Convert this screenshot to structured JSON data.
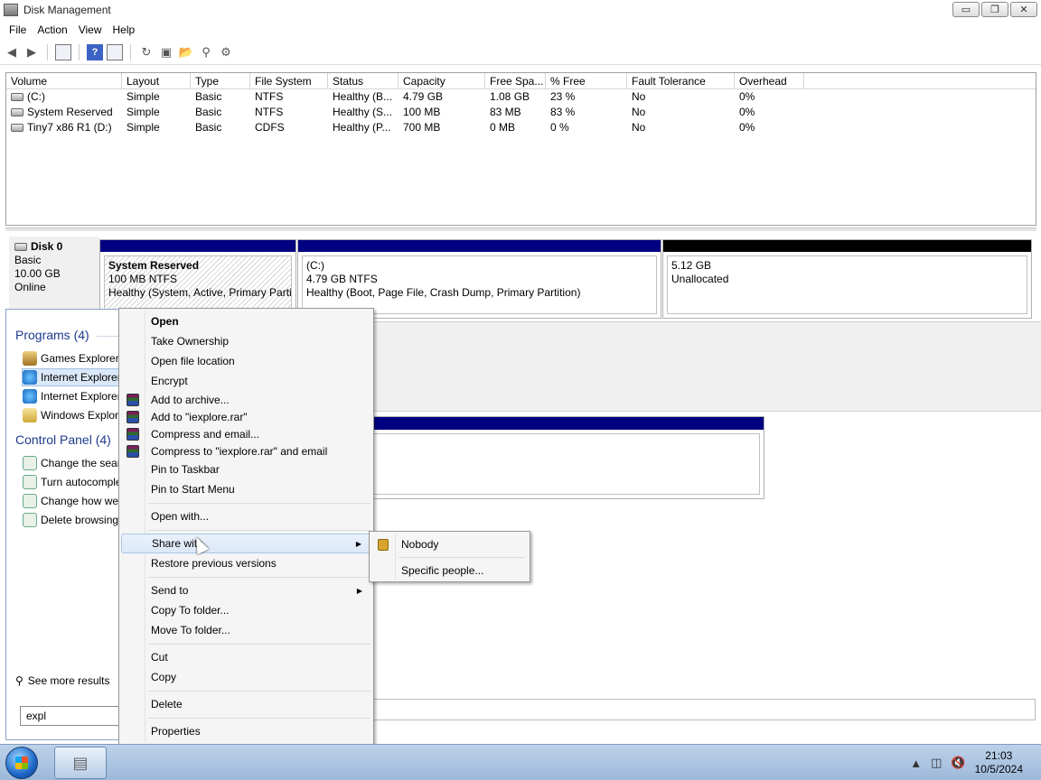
{
  "window": {
    "title": "Disk Management",
    "minimize": "▭",
    "maximize": "❐",
    "close": "✕"
  },
  "menubar": [
    {
      "label": "File"
    },
    {
      "label": "Action"
    },
    {
      "label": "View"
    },
    {
      "label": "Help"
    }
  ],
  "volumes": {
    "columns": [
      "Volume",
      "Layout",
      "Type",
      "File System",
      "Status",
      "Capacity",
      "Free Spa...",
      "% Free",
      "Fault Tolerance",
      "Overhead"
    ],
    "rows": [
      [
        "(C:)",
        "Simple",
        "Basic",
        "NTFS",
        "Healthy (B...",
        "4.79 GB",
        "1.08 GB",
        "23 %",
        "No",
        "0%"
      ],
      [
        "System Reserved",
        "Simple",
        "Basic",
        "NTFS",
        "Healthy (S...",
        "100 MB",
        "83 MB",
        "83 %",
        "No",
        "0%"
      ],
      [
        "Tiny7 x86 R1 (D:)",
        "Simple",
        "Basic",
        "CDFS",
        "Healthy (P...",
        "700 MB",
        "0 MB",
        "0 %",
        "No",
        "0%"
      ]
    ]
  },
  "disk0": {
    "name": "Disk 0",
    "type": "Basic",
    "size": "10.00 GB",
    "status": "Online",
    "partitions": [
      {
        "title": "System Reserved",
        "size": "100 MB NTFS",
        "status": "Healthy (System, Active, Primary Partit"
      },
      {
        "title": "(C:)",
        "size": "4.79 GB NTFS",
        "status": "Healthy (Boot, Page File, Crash Dump, Primary Partition)"
      },
      {
        "title": "",
        "size": "5.12 GB",
        "status": "Unallocated"
      }
    ]
  },
  "startmenu": {
    "programs_header": "Programs (4)",
    "programs": [
      "Games Explorer",
      "Internet Explorer",
      "Internet Explorer",
      "Windows Explorer"
    ],
    "control_header": "Control Panel (4)",
    "control": [
      "Change the search",
      "Turn autocomplete",
      "Change how web",
      "Delete browsing"
    ],
    "see_more": "See more results",
    "search_value": "expl"
  },
  "context_menu": {
    "items": [
      "Open",
      "Take Ownership",
      "Open file location",
      "Encrypt",
      "Add to archive...",
      "Add to \"iexplore.rar\"",
      "Compress and email...",
      "Compress to \"iexplore.rar\" and email",
      "Pin to Taskbar",
      "Pin to Start Menu",
      "Open with...",
      "Share with",
      "Restore previous versions",
      "Send to",
      "Copy To folder...",
      "Move To folder...",
      "Cut",
      "Copy",
      "Delete",
      "Properties"
    ]
  },
  "share_submenu": {
    "items": [
      "Nobody",
      "Specific people..."
    ]
  },
  "taskbar": {
    "time": "21:03",
    "date": "10/5/2024"
  }
}
